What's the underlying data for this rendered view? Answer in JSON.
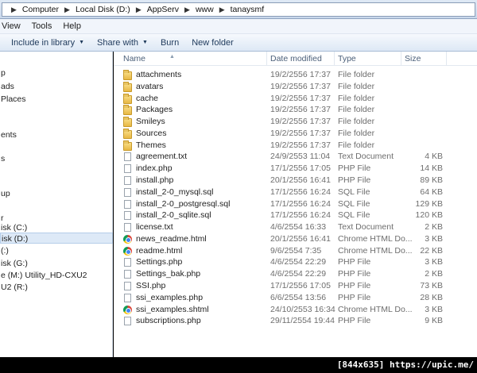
{
  "breadcrumb": [
    "Computer",
    "Local Disk (D:)",
    "AppServ",
    "www",
    "tanaysmf"
  ],
  "menu": [
    "View",
    "Tools",
    "Help"
  ],
  "commands": [
    {
      "label": "Include in library",
      "dropdown": true
    },
    {
      "label": "Share with",
      "dropdown": true
    },
    {
      "label": "Burn",
      "dropdown": false
    },
    {
      "label": "New folder",
      "dropdown": false
    }
  ],
  "nav_items": [
    {
      "label": "p",
      "selected": false
    },
    {
      "label": "ads",
      "selected": false
    },
    {
      "label": "Places",
      "selected": false
    },
    {
      "label": "ents",
      "selected": false
    },
    {
      "label": "s",
      "selected": false
    },
    {
      "label": "up",
      "selected": false
    },
    {
      "label": "r",
      "selected": false
    },
    {
      "label": "isk (C:)",
      "selected": false
    },
    {
      "label": "isk (D:)",
      "selected": true
    },
    {
      "label": "(:)",
      "selected": false
    },
    {
      "label": "isk (G:)",
      "selected": false
    },
    {
      "label": "e (M:) Utility_HD-CXU2",
      "selected": false
    },
    {
      "label": "U2 (R:)",
      "selected": false
    }
  ],
  "columns": {
    "name": "Name",
    "date": "Date modified",
    "type": "Type",
    "size": "Size"
  },
  "files": [
    {
      "name": "attachments",
      "date": "19/2/2556 17:37",
      "type": "File folder",
      "size": "",
      "icon": "folder-icon"
    },
    {
      "name": "avatars",
      "date": "19/2/2556 17:37",
      "type": "File folder",
      "size": "",
      "icon": "folder-icon"
    },
    {
      "name": "cache",
      "date": "19/2/2556 17:37",
      "type": "File folder",
      "size": "",
      "icon": "folder-icon"
    },
    {
      "name": "Packages",
      "date": "19/2/2556 17:37",
      "type": "File folder",
      "size": "",
      "icon": "folder-icon"
    },
    {
      "name": "Smileys",
      "date": "19/2/2556 17:37",
      "type": "File folder",
      "size": "",
      "icon": "folder-icon"
    },
    {
      "name": "Sources",
      "date": "19/2/2556 17:37",
      "type": "File folder",
      "size": "",
      "icon": "folder-icon"
    },
    {
      "name": "Themes",
      "date": "19/2/2556 17:37",
      "type": "File folder",
      "size": "",
      "icon": "folder-icon"
    },
    {
      "name": "agreement.txt",
      "date": "24/9/2553 11:04",
      "type": "Text Document",
      "size": "4 KB",
      "icon": "document-icon"
    },
    {
      "name": "index.php",
      "date": "17/1/2556 17:05",
      "type": "PHP File",
      "size": "14 KB",
      "icon": "document-icon"
    },
    {
      "name": "install.php",
      "date": "20/1/2556 16:41",
      "type": "PHP File",
      "size": "89 KB",
      "icon": "document-icon"
    },
    {
      "name": "install_2-0_mysql.sql",
      "date": "17/1/2556 16:24",
      "type": "SQL File",
      "size": "64 KB",
      "icon": "document-icon"
    },
    {
      "name": "install_2-0_postgresql.sql",
      "date": "17/1/2556 16:24",
      "type": "SQL File",
      "size": "129 KB",
      "icon": "document-icon"
    },
    {
      "name": "install_2-0_sqlite.sql",
      "date": "17/1/2556 16:24",
      "type": "SQL File",
      "size": "120 KB",
      "icon": "document-icon"
    },
    {
      "name": "license.txt",
      "date": "4/6/2554 16:33",
      "type": "Text Document",
      "size": "2 KB",
      "icon": "document-icon"
    },
    {
      "name": "news_readme.html",
      "date": "20/1/2556 16:41",
      "type": "Chrome HTML Do...",
      "size": "3 KB",
      "icon": "chrome-icon"
    },
    {
      "name": "readme.html",
      "date": "9/6/2554 7:35",
      "type": "Chrome HTML Do...",
      "size": "22 KB",
      "icon": "chrome-icon"
    },
    {
      "name": "Settings.php",
      "date": "4/6/2554 22:29",
      "type": "PHP File",
      "size": "3 KB",
      "icon": "document-icon"
    },
    {
      "name": "Settings_bak.php",
      "date": "4/6/2554 22:29",
      "type": "PHP File",
      "size": "2 KB",
      "icon": "document-icon"
    },
    {
      "name": "SSI.php",
      "date": "17/1/2556 17:05",
      "type": "PHP File",
      "size": "73 KB",
      "icon": "document-icon"
    },
    {
      "name": "ssi_examples.php",
      "date": "6/6/2554 13:56",
      "type": "PHP File",
      "size": "28 KB",
      "icon": "document-icon"
    },
    {
      "name": "ssi_examples.shtml",
      "date": "24/10/2553 16:34",
      "type": "Chrome HTML Do...",
      "size": "3 KB",
      "icon": "chrome-icon"
    },
    {
      "name": "subscriptions.php",
      "date": "29/11/2554 19:44",
      "type": "PHP File",
      "size": "9 KB",
      "icon": "document-icon"
    }
  ],
  "watermark": "[844x635] https://upic.me/"
}
